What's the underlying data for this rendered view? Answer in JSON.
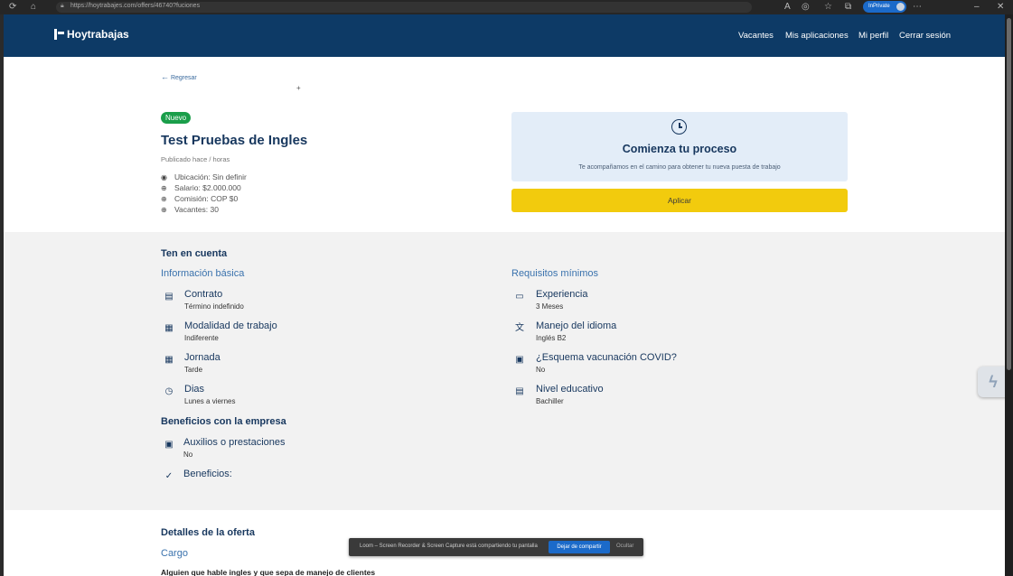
{
  "browser": {
    "url": "https://hoytrabajes.com/offers/46740?fuciones",
    "inprivate_label": "InPrivate"
  },
  "header": {
    "logo": "Hoytrabajas",
    "nav": [
      "Vacantes",
      "Mis aplicaciones",
      "Mi perfil",
      "Cerrar sesión"
    ]
  },
  "offer": {
    "back": "Regresar",
    "badge": "Nuevo",
    "title": "Test Pruebas de Ingles",
    "published": "Publicado hace / horas",
    "meta": [
      {
        "icon": "location-icon",
        "text": "Ubicación: Sin definir"
      },
      {
        "icon": "money-icon",
        "text": "Salario: $2.000.000"
      },
      {
        "icon": "money-icon",
        "text": "Comisión: COP $0"
      },
      {
        "icon": "money-icon",
        "text": "Vacantes: 30"
      }
    ]
  },
  "process_card": {
    "title": "Comienza tu proceso",
    "subtitle": "Te acompañamos en el camino para obtener tu nueva puesta de trabajo",
    "apply": "Aplicar"
  },
  "info": {
    "heading": "Ten en cuenta",
    "basic_heading": "Información básica",
    "basic": [
      {
        "icon": "document-icon",
        "label": "Contrato",
        "value": "Término indefinido"
      },
      {
        "icon": "calendar-icon",
        "label": "Modalidad de trabajo",
        "value": "Indiferente"
      },
      {
        "icon": "calendar-icon",
        "label": "Jornada",
        "value": "Tarde"
      },
      {
        "icon": "clock-icon",
        "label": "Dias",
        "value": "Lunes a viernes"
      }
    ],
    "req_heading": "Requisitos mínimos",
    "requirements": [
      {
        "icon": "briefcase-icon",
        "label": "Experiencia",
        "value": "3 Meses"
      },
      {
        "icon": "translate-icon",
        "label": "Manejo del idioma",
        "value": "Inglés B2"
      },
      {
        "icon": "id-badge-icon",
        "label": "¿Esquema vacunación COVID?",
        "value": "No"
      },
      {
        "icon": "document-icon",
        "label": "Nivel educativo",
        "value": "Bachiller"
      }
    ],
    "benefits_heading": "Beneficios con la empresa",
    "benefits": [
      {
        "icon": "cash-icon",
        "label": "Auxilios o prestaciones",
        "value": "No"
      },
      {
        "icon": "check-circle-icon",
        "label": "Beneficios:",
        "value": ""
      }
    ]
  },
  "details": {
    "heading": "Detalles de la oferta",
    "cargo_heading": "Cargo",
    "cargo_desc": "Alguien que hable ingles y que sepa de manejo de clientes"
  },
  "share_bar": {
    "text": "Loom – Screen Recorder & Screen Capture está compartiendo tu pantalla",
    "stop": "Dejar de compartir",
    "hide": "Ocultar"
  }
}
